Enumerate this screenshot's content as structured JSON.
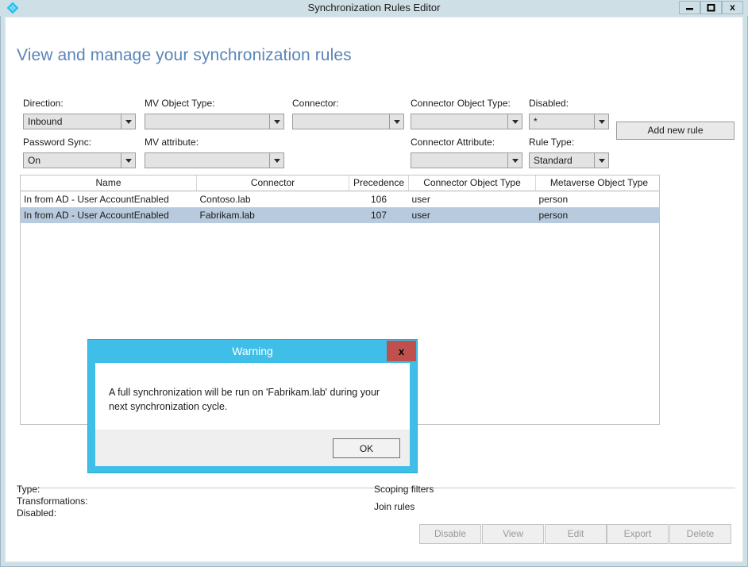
{
  "window": {
    "title": "Synchronization Rules Editor",
    "app_icon": "sync-diamond-icon",
    "minimize_label": "–",
    "maximize_label": "❐",
    "close_label": "x"
  },
  "page_title": "View and manage your synchronization rules",
  "filters": {
    "direction": {
      "label": "Direction:",
      "value": "Inbound"
    },
    "mv_object_type": {
      "label": "MV Object Type:",
      "value": ""
    },
    "connector": {
      "label": "Connector:",
      "value": ""
    },
    "connector_object_type": {
      "label": "Connector Object Type:",
      "value": ""
    },
    "disabled": {
      "label": "Disabled:",
      "value": "*"
    },
    "password_sync": {
      "label": "Password Sync:",
      "value": "On"
    },
    "mv_attribute": {
      "label": "MV attribute:",
      "value": ""
    },
    "connector_attribute": {
      "label": "Connector Attribute:",
      "value": ""
    },
    "rule_type": {
      "label": "Rule Type:",
      "value": "Standard"
    }
  },
  "add_new_rule_label": "Add new rule",
  "grid": {
    "columns": [
      "Name",
      "Connector",
      "Precedence",
      "Connector Object Type",
      "Metaverse Object Type"
    ],
    "rows": [
      {
        "name": "In from AD - User AccountEnabled",
        "connector": "Contoso.lab",
        "precedence": "106",
        "connector_object_type": "user",
        "metaverse_object_type": "person",
        "selected": false
      },
      {
        "name": "In from AD - User AccountEnabled",
        "connector": "Fabrikam.lab",
        "precedence": "107",
        "connector_object_type": "user",
        "metaverse_object_type": "person",
        "selected": true
      }
    ]
  },
  "detail": {
    "type_label": "Type:",
    "transformations_label": "Transformations:",
    "disabled_label": "Disabled:",
    "scoping_filters_label": "Scoping filters",
    "join_rules_label": "Join rules"
  },
  "bottom_buttons": [
    {
      "label": "Disable",
      "disabled": true
    },
    {
      "label": "View",
      "disabled": true
    },
    {
      "label": "Edit",
      "disabled": true
    },
    {
      "label": "Export",
      "disabled": true
    },
    {
      "label": "Delete",
      "disabled": true
    }
  ],
  "dialog": {
    "title": "Warning",
    "close_label": "x",
    "message": "A full synchronization will be run on 'Fabrikam.lab' during your next synchronization cycle.",
    "ok_label": "OK"
  },
  "colors": {
    "title_bar": "#cfdfe6",
    "page_title_text": "#5a85b8",
    "dialog_accent": "#3fbfe8",
    "dialog_close": "#c0504d",
    "row_selected": "#b8cadd",
    "app_icon": "#29c3f0"
  }
}
